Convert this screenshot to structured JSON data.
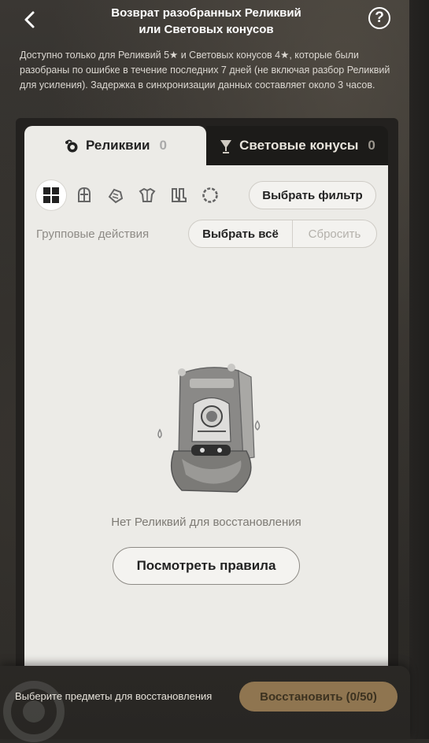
{
  "header": {
    "title_line1": "Возврат разобранных Реликвий",
    "title_line2": "или Световых конусов",
    "help_label": "?"
  },
  "description": "Доступно только для Реликвий 5★ и Световых конусов 4★, которые были разобраны по ошибке в течение последних 7 дней (не включая разбор Реликвий для усиления). Задержка в синхронизации данных составляет около 3 часов.",
  "tabs": [
    {
      "label": "Реликвии",
      "count": "0",
      "icon": "relic-icon",
      "active": true
    },
    {
      "label": "Световые конусы",
      "count": "0",
      "icon": "light-cone-icon",
      "active": false
    }
  ],
  "filters": {
    "categories": [
      "all-grid-icon",
      "head-icon",
      "hands-icon",
      "body-icon",
      "feet-icon",
      "sphere-icon"
    ],
    "filter_button": "Выбрать фильтр"
  },
  "group_actions": {
    "label": "Групповые действия",
    "select_all": "Выбрать всё",
    "reset": "Сбросить"
  },
  "empty_state": {
    "message": "Нет Реликвий для восстановления",
    "rules_button": "Посмотреть правила"
  },
  "footer": {
    "hint": "Выберите предметы для восстановления",
    "restore_button": "Восстановить (0/50)"
  },
  "colors": {
    "accent_gold": "#8f7550",
    "panel_light": "#ecebe7",
    "panel_dark": "#1c1b19"
  }
}
